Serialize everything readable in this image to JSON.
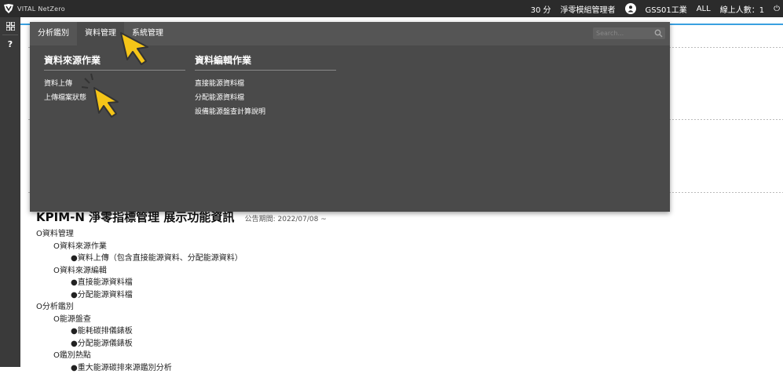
{
  "header": {
    "brand": "VITAL NetZero",
    "timer": "30 分",
    "role": "淨零模組管理者",
    "org": "GSS01工業",
    "scope": "ALL",
    "online": "線上人數：1",
    "logout_glyph": "⏻"
  },
  "rail": {
    "apps_icon": "grid-icon",
    "help_label": "?"
  },
  "menu": {
    "tabs": [
      "分析鑑別",
      "資料管理",
      "系統管理"
    ],
    "search_placeholder": "Search...",
    "columns": [
      {
        "title": "資料來源作業",
        "items": [
          "資料上傳",
          "上傳檔案狀態"
        ]
      },
      {
        "title": "資料編輯作業",
        "items": [
          "直接能源資料檔",
          "分配能源資料檔",
          "設備能源盤查計算說明"
        ]
      }
    ]
  },
  "announcement": {
    "title": "KPIM-N 淨零指標管理 展示功能資訊",
    "date": "公告期間: 2022/07/08 ~",
    "tree": [
      {
        "level": 1,
        "text": "O資料管理"
      },
      {
        "level": 2,
        "text": "O資料來源作業"
      },
      {
        "level": 3,
        "text": "●資料上傳（包含直接能源資料、分配能源資料）"
      },
      {
        "level": 2,
        "text": "O資料來源編輯"
      },
      {
        "level": 3,
        "text": "●直接能源資料檔"
      },
      {
        "level": 3,
        "text": "●分配能源資料檔"
      },
      {
        "level": 1,
        "text": "O分析鑑別"
      },
      {
        "level": 2,
        "text": "O能源盤查"
      },
      {
        "level": 3,
        "text": "●能耗碳排儀錶板"
      },
      {
        "level": 3,
        "text": "●分配能源儀錶板"
      },
      {
        "level": 2,
        "text": "O鑑別熱點"
      },
      {
        "level": 3,
        "text": "●重大能源碳排來源鑑別分析"
      }
    ]
  },
  "colors": {
    "topbar": "#2b2b2b",
    "menu_bg": "#4a4a4a",
    "accent": "#39a0e0",
    "cursor": "#f5c518"
  }
}
